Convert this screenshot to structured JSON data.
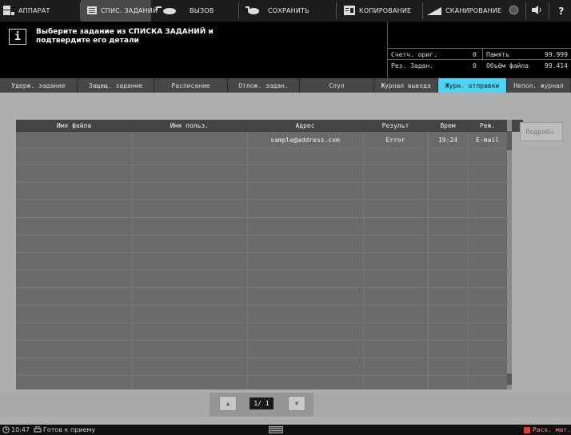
{
  "topbar": {
    "machine": "АППАРАТ",
    "job_list": "СПИС. ЗАДАНИЙ",
    "recall": "ВЫЗОВ",
    "save": "СОХРАНИТЬ",
    "copy": "КОПИРОВАНИЕ",
    "scan": "СКАНИРОВАНИЕ",
    "help": "?"
  },
  "message": {
    "line1": "Выберите задание из СПИСКА ЗАДАНИЙ и",
    "line2": "подтвердите его детали",
    "info_icon": "i"
  },
  "counters": {
    "orig_label": "Счетч. ориг.",
    "orig_value": "0",
    "reserved_label": "Рез. Задан.",
    "reserved_value": "0",
    "memory_label": "Память",
    "memory_value": "99.999",
    "filesize_label": "Объём файла",
    "filesize_value": "99.414"
  },
  "tabs": [
    {
      "label": "Удерж. задание"
    },
    {
      "label": "Защищ. задание"
    },
    {
      "label": "Расписание"
    },
    {
      "label": "Отлож. задан."
    },
    {
      "label": "Спул"
    },
    {
      "label": "Журнал вывода"
    },
    {
      "label": "Журн. отправки"
    },
    {
      "label": "Непол. журнал"
    }
  ],
  "table": {
    "headers": [
      "Имя файла",
      "Имя польз.",
      "Адрес",
      "Результ",
      "Врем",
      "Реж."
    ],
    "rows": [
      [
        "",
        "",
        "sample@address.com",
        "Error",
        "19:24",
        "E-mail"
      ]
    ]
  },
  "details_button": "Подробн.",
  "pager": {
    "page": "1/ 1",
    "up": "▲",
    "down": "▼"
  },
  "status": {
    "time": "10:47",
    "ready": "Готов к приему",
    "warning": "Расх. мат."
  },
  "colors": {
    "active_tab": "#4fd3f3",
    "table_bg": "#6a6a6a",
    "header_bg": "#444444"
  }
}
